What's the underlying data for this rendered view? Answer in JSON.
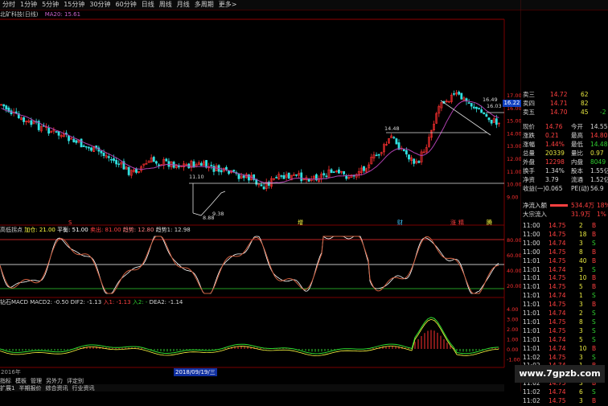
{
  "toolbar": {
    "periods": [
      "分时",
      "1分钟",
      "5分钟",
      "15分钟",
      "30分钟",
      "60分钟",
      "日线",
      "周线",
      "月线",
      "多周期",
      "更多>"
    ]
  },
  "stock": {
    "name": "北矿科技(日线)",
    "ma_label": "MA20: 15.61"
  },
  "price_axis": {
    "ticks": [
      "17.00",
      "16.00",
      "15.00",
      "14.00",
      "13.00",
      "12.00",
      "11.00",
      "10.00",
      "9.00"
    ],
    "current_price_box": "16.22"
  },
  "price_annotations": {
    "high_label": "16.49",
    "high2_label": "16.03",
    "peak_label": "14.48",
    "level_label": "11.10",
    "low_label": "9.38",
    "low2_label": "8.88"
  },
  "event_markers": [
    "S",
    "增",
    "财",
    "涨",
    "精",
    "腾"
  ],
  "indicator1": {
    "title": "高低拐点",
    "params": [
      {
        "text": "加仓: 21.00",
        "color": "#ffff40"
      },
      {
        "text": "平衡: 51.00",
        "color": "#ffffff"
      },
      {
        "text": "卖出: 81.00",
        "color": "#ff4040"
      },
      {
        "text": "趋势: 12.80",
        "color": "#ff8080"
      },
      {
        "text": "趋势1: 12.98",
        "color": "#d8d8d8"
      }
    ],
    "ticks": [
      "80.00",
      "60.00",
      "40.00",
      "20.00"
    ]
  },
  "indicator2": {
    "title": "钻石MACD",
    "params": [
      {
        "text": "MACD2: -0.50",
        "color": "#d8d8d8"
      },
      {
        "text": "DIF2: -1.13",
        "color": "#d8d8d8"
      },
      {
        "text": "入1: -1.13",
        "color": "#ff4040"
      },
      {
        "text": "入2: -",
        "color": "#30d030"
      },
      {
        "text": "DEA2: -1.14",
        "color": "#d8d8d8"
      }
    ],
    "ticks": [
      "4.00",
      "3.00",
      "2.00",
      "1.00",
      "0.00",
      "-1.00"
    ]
  },
  "date_axis": {
    "left_label": "2016年",
    "highlight": "2018/09/19/三"
  },
  "tabs": [
    "指标",
    "模板",
    "管理",
    "另外力",
    "评定别"
  ],
  "bottom_tabs": [
    "扩展1",
    "半期报价",
    "综合资讯",
    "行业资讯"
  ],
  "order_book": [
    {
      "label": "卖三",
      "price": "14.72",
      "vol": "62",
      "chg": ""
    },
    {
      "label": "卖四",
      "price": "14.71",
      "vol": "82",
      "chg": ""
    },
    {
      "label": "卖五",
      "price": "14.70",
      "vol": "45",
      "chg": "-2"
    }
  ],
  "quote": [
    {
      "l1": "现价",
      "v1": "14.76",
      "l2": "今开",
      "v2": "14.55",
      "c1": "red",
      "c2": "wht"
    },
    {
      "l1": "涨跌",
      "v1": "0.21",
      "l2": "最高",
      "v2": "14.80",
      "c1": "red",
      "c2": "red"
    },
    {
      "l1": "涨幅",
      "v1": "1.44%",
      "l2": "最低",
      "v2": "14.48",
      "c1": "red",
      "c2": "grn"
    },
    {
      "l1": "总量",
      "v1": "20339",
      "l2": "量比",
      "v2": "0.97",
      "c1": "yel",
      "c2": "yel"
    },
    {
      "l1": "外盘",
      "v1": "12298",
      "l2": "内盘",
      "v2": "8049",
      "c1": "red",
      "c2": "grn"
    },
    {
      "l1": "换手",
      "v1": "1.34%",
      "l2": "股本",
      "v2": "1.55亿",
      "c1": "wht",
      "c2": "wht"
    },
    {
      "l1": "净资",
      "v1": "3.79",
      "l2": "流通",
      "v2": "1.52亿",
      "c1": "wht",
      "c2": "wht"
    },
    {
      "l1": "收益(一)",
      "v1": "0.065",
      "l2": "PE(动)",
      "v2": "56.9",
      "c1": "wht",
      "c2": "wht"
    }
  ],
  "fund_flow": [
    {
      "label": "净流入额",
      "value": "534.4万",
      "pct": "18%"
    },
    {
      "label": "大宗流入",
      "value": "31.9万",
      "pct": "1%"
    }
  ],
  "trades": [
    {
      "time": "11:00",
      "price": "14.75",
      "vol": "2",
      "side": "B"
    },
    {
      "time": "11:00",
      "price": "14.75",
      "vol": "18",
      "side": "B"
    },
    {
      "time": "11:00",
      "price": "14.74",
      "vol": "3",
      "side": "S"
    },
    {
      "time": "11:00",
      "price": "14.75",
      "vol": "8",
      "side": "B"
    },
    {
      "time": "11:01",
      "price": "14.75",
      "vol": "40",
      "side": "B"
    },
    {
      "time": "11:01",
      "price": "14.74",
      "vol": "3",
      "side": "S"
    },
    {
      "time": "11:01",
      "price": "14.75",
      "vol": "10",
      "side": "B"
    },
    {
      "time": "11:01",
      "price": "14.75",
      "vol": "5",
      "side": "B"
    },
    {
      "time": "11:01",
      "price": "14.74",
      "vol": "1",
      "side": "S"
    },
    {
      "time": "11:01",
      "price": "14.75",
      "vol": "3",
      "side": "B"
    },
    {
      "time": "11:01",
      "price": "14.74",
      "vol": "2",
      "side": "S"
    },
    {
      "time": "11:01",
      "price": "14.75",
      "vol": "8",
      "side": "S"
    },
    {
      "time": "11:01",
      "price": "14.75",
      "vol": "3",
      "side": "S"
    },
    {
      "time": "11:01",
      "price": "14.74",
      "vol": "5",
      "side": "S"
    },
    {
      "time": "11:01",
      "price": "14.74",
      "vol": "10",
      "side": "B"
    },
    {
      "time": "11:02",
      "price": "14.75",
      "vol": "3",
      "side": "S"
    },
    {
      "time": "11:02",
      "price": "14.74",
      "vol": "1",
      "side": "B"
    },
    {
      "time": "11:02",
      "price": "14.75",
      "vol": "5",
      "side": "B"
    },
    {
      "time": "11:02",
      "price": "14.75",
      "vol": "3",
      "side": "B"
    },
    {
      "time": "11:02",
      "price": "14.74",
      "vol": "6",
      "side": "S"
    },
    {
      "time": "11:02",
      "price": "14.75",
      "vol": "3",
      "side": "B"
    }
  ],
  "watermark": "www.7gpzb.com",
  "colors": {
    "up": "#ff3030",
    "down": "#30e0e0",
    "ma": "#b040b0",
    "panel_border": "#7a0000"
  }
}
